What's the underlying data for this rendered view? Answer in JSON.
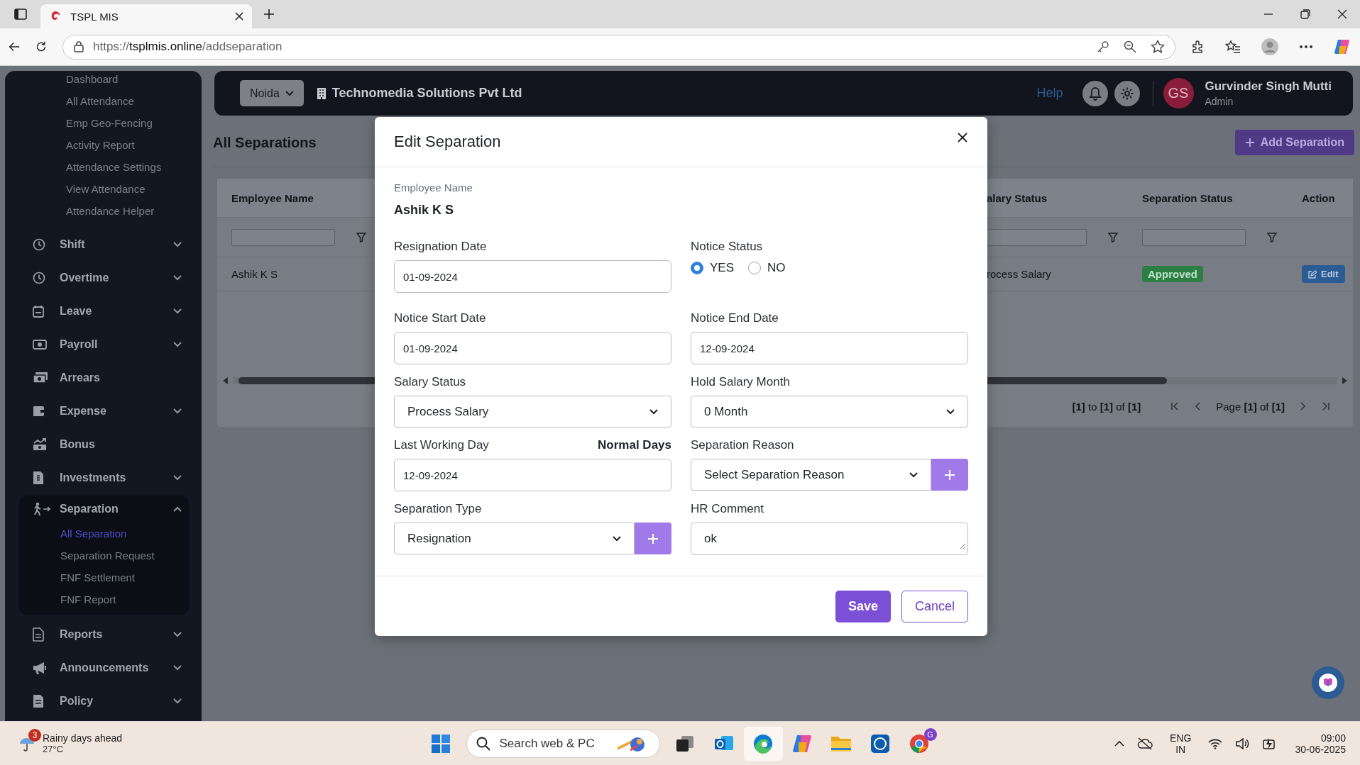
{
  "browser": {
    "tab_title": "TSPL MIS",
    "url_scheme": "https://",
    "url_host": "tsplmis.online",
    "url_path": "/addseparation"
  },
  "sidebar": {
    "attendance_items": [
      {
        "label": "Dashboard",
        "selected": false
      },
      {
        "label": "All Attendance",
        "selected": false
      },
      {
        "label": "Emp Geo-Fencing",
        "selected": false
      },
      {
        "label": "Activity Report",
        "selected": false
      },
      {
        "label": "Attendance Settings",
        "selected": false
      },
      {
        "label": "View Attendance",
        "selected": false
      },
      {
        "label": "Attendance Helper",
        "selected": false
      }
    ],
    "items": [
      {
        "label": "Shift",
        "has_submenu": true,
        "expanded": false
      },
      {
        "label": "Overtime",
        "has_submenu": true,
        "expanded": false
      },
      {
        "label": "Leave",
        "has_submenu": true,
        "expanded": false
      },
      {
        "label": "Payroll",
        "has_submenu": true,
        "expanded": false
      },
      {
        "label": "Arrears",
        "has_submenu": false,
        "expanded": false
      },
      {
        "label": "Expense",
        "has_submenu": true,
        "expanded": false
      },
      {
        "label": "Bonus",
        "has_submenu": false,
        "expanded": false
      },
      {
        "label": "Investments",
        "has_submenu": true,
        "expanded": false
      },
      {
        "label": "Separation",
        "has_submenu": true,
        "expanded": true,
        "children": [
          {
            "label": "All Separation",
            "selected": true
          },
          {
            "label": "Separation Request",
            "selected": false
          },
          {
            "label": "FNF Settlement",
            "selected": false
          },
          {
            "label": "FNF Report",
            "selected": false
          }
        ]
      },
      {
        "label": "Reports",
        "has_submenu": true,
        "expanded": false
      },
      {
        "label": "Announcements",
        "has_submenu": true,
        "expanded": false
      },
      {
        "label": "Policy",
        "has_submenu": true,
        "expanded": false
      }
    ]
  },
  "header": {
    "location": "Noida",
    "company": "Technomedia Solutions Pvt Ltd",
    "help": "Help",
    "avatar": "GS",
    "user_name": "Gurvinder Singh Mutti",
    "user_role": "Admin"
  },
  "page": {
    "title": "All Separations",
    "add_button": "Add Separation"
  },
  "table": {
    "columns": [
      "Employee Name",
      "alary Status",
      "Separation Status",
      "Action"
    ],
    "rows": [
      {
        "employee": "Ashik K S",
        "salary_status": "rocess Salary",
        "separation_status": "Approved",
        "action": "Edit"
      }
    ],
    "range": "**[1]** to **[1]** of **[1]**",
    "page": "Page **[1]** of **[1]**"
  },
  "modal": {
    "title": "Edit Separation",
    "employee_label": "Employee Name",
    "employee_name": "Ashik K S",
    "fields": [
      {
        "kind": "date",
        "label": "Resignation Date",
        "value": "01-09-2024"
      },
      {
        "kind": "radio",
        "label": "Notice Status",
        "options": [
          {
            "label": "YES",
            "selected": true
          },
          {
            "label": "NO",
            "selected": false
          }
        ]
      },
      {
        "kind": "date",
        "label": "Notice Start Date",
        "value": "01-09-2024"
      },
      {
        "kind": "date",
        "label": "Notice End Date",
        "value": "12-09-2024"
      },
      {
        "kind": "select",
        "label": "Salary Status",
        "value": "Process Salary"
      },
      {
        "kind": "select",
        "label": "Hold Salary Month",
        "value": "0 Month"
      },
      {
        "kind": "date",
        "label": "Last Working Day",
        "note": "Normal Days",
        "value": "12-09-2024"
      },
      {
        "kind": "select_add",
        "label": "Separation Reason",
        "value": "Select Separation Reason"
      },
      {
        "kind": "select_add",
        "label": "Separation Type",
        "value": "Resignation"
      },
      {
        "kind": "textarea",
        "label": "HR Comment",
        "value": "ok"
      }
    ],
    "save": "Save",
    "cancel": "Cancel"
  },
  "taskbar": {
    "weather_badge": "3",
    "weather_title": "Rainy days ahead",
    "temperature": "27°C",
    "search_placeholder": "Search web & PC",
    "profile_badge": "G",
    "language": "ENG",
    "region": "IN",
    "time": "09:00",
    "date": "30-06-2025"
  }
}
